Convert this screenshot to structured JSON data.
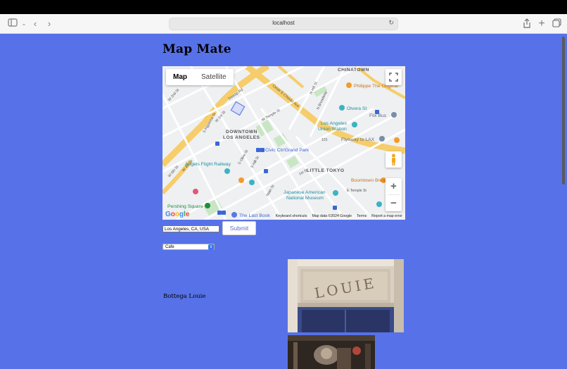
{
  "browser": {
    "url": "localhost"
  },
  "page": {
    "title": "Map Mate"
  },
  "map": {
    "type_options": [
      "Map",
      "Satellite"
    ],
    "active_type": "Map",
    "labels": {
      "chinatown": "CHINATOWN",
      "downtown_1": "DOWNTOWN",
      "downtown_2": "LOS ANGELES",
      "little_tokyo": "LITTLE TOKYO",
      "philippe": "Philippe The Original",
      "olvera": "Olvera St",
      "flix_bus": "Flix Bus",
      "union_station_1": "Los Angeles",
      "union_station_2": "Union Station",
      "flyaway": "Flyaway to LAX",
      "civic_center": "Civic Ctr/Grand Park",
      "angels_flight": "Angels Flight Railway",
      "boomtown": "Boomtown Brewery",
      "jana_1": "Japanese American",
      "jana_2": "National Museum",
      "pershing": "Pershing Square",
      "last_book": "The Last Book",
      "temple_st": "W Temple St",
      "first_st": "1st St",
      "main_st": "Main St",
      "hill_st": "N Hill St",
      "broadway": "N Broadway",
      "figueroa": "S Figueroa St",
      "olive": "S Olive St",
      "s_hill": "S Hill St",
      "cesar": "Cesar E Chavez Ave",
      "dewap": "Dewap Rd",
      "w_2nd": "W 2nd St",
      "w_1st": "W 1st St",
      "w_5th": "W 5th St",
      "w_4th": "W 4th St",
      "e_temple": "E Temple St",
      "hwy_101": "101"
    },
    "footer": [
      "Keyboard shortcuts",
      "Map data ©2024 Google",
      "Terms",
      "Report a map error"
    ],
    "zoom_in": "+",
    "zoom_out": "−"
  },
  "form": {
    "location_value": "Los Angeles, CA, USA",
    "submit_label": "Submit",
    "category_selected": "Cafe"
  },
  "results": [
    {
      "name": "Bottega Louie",
      "photo_sign": "LOUIE"
    }
  ]
}
